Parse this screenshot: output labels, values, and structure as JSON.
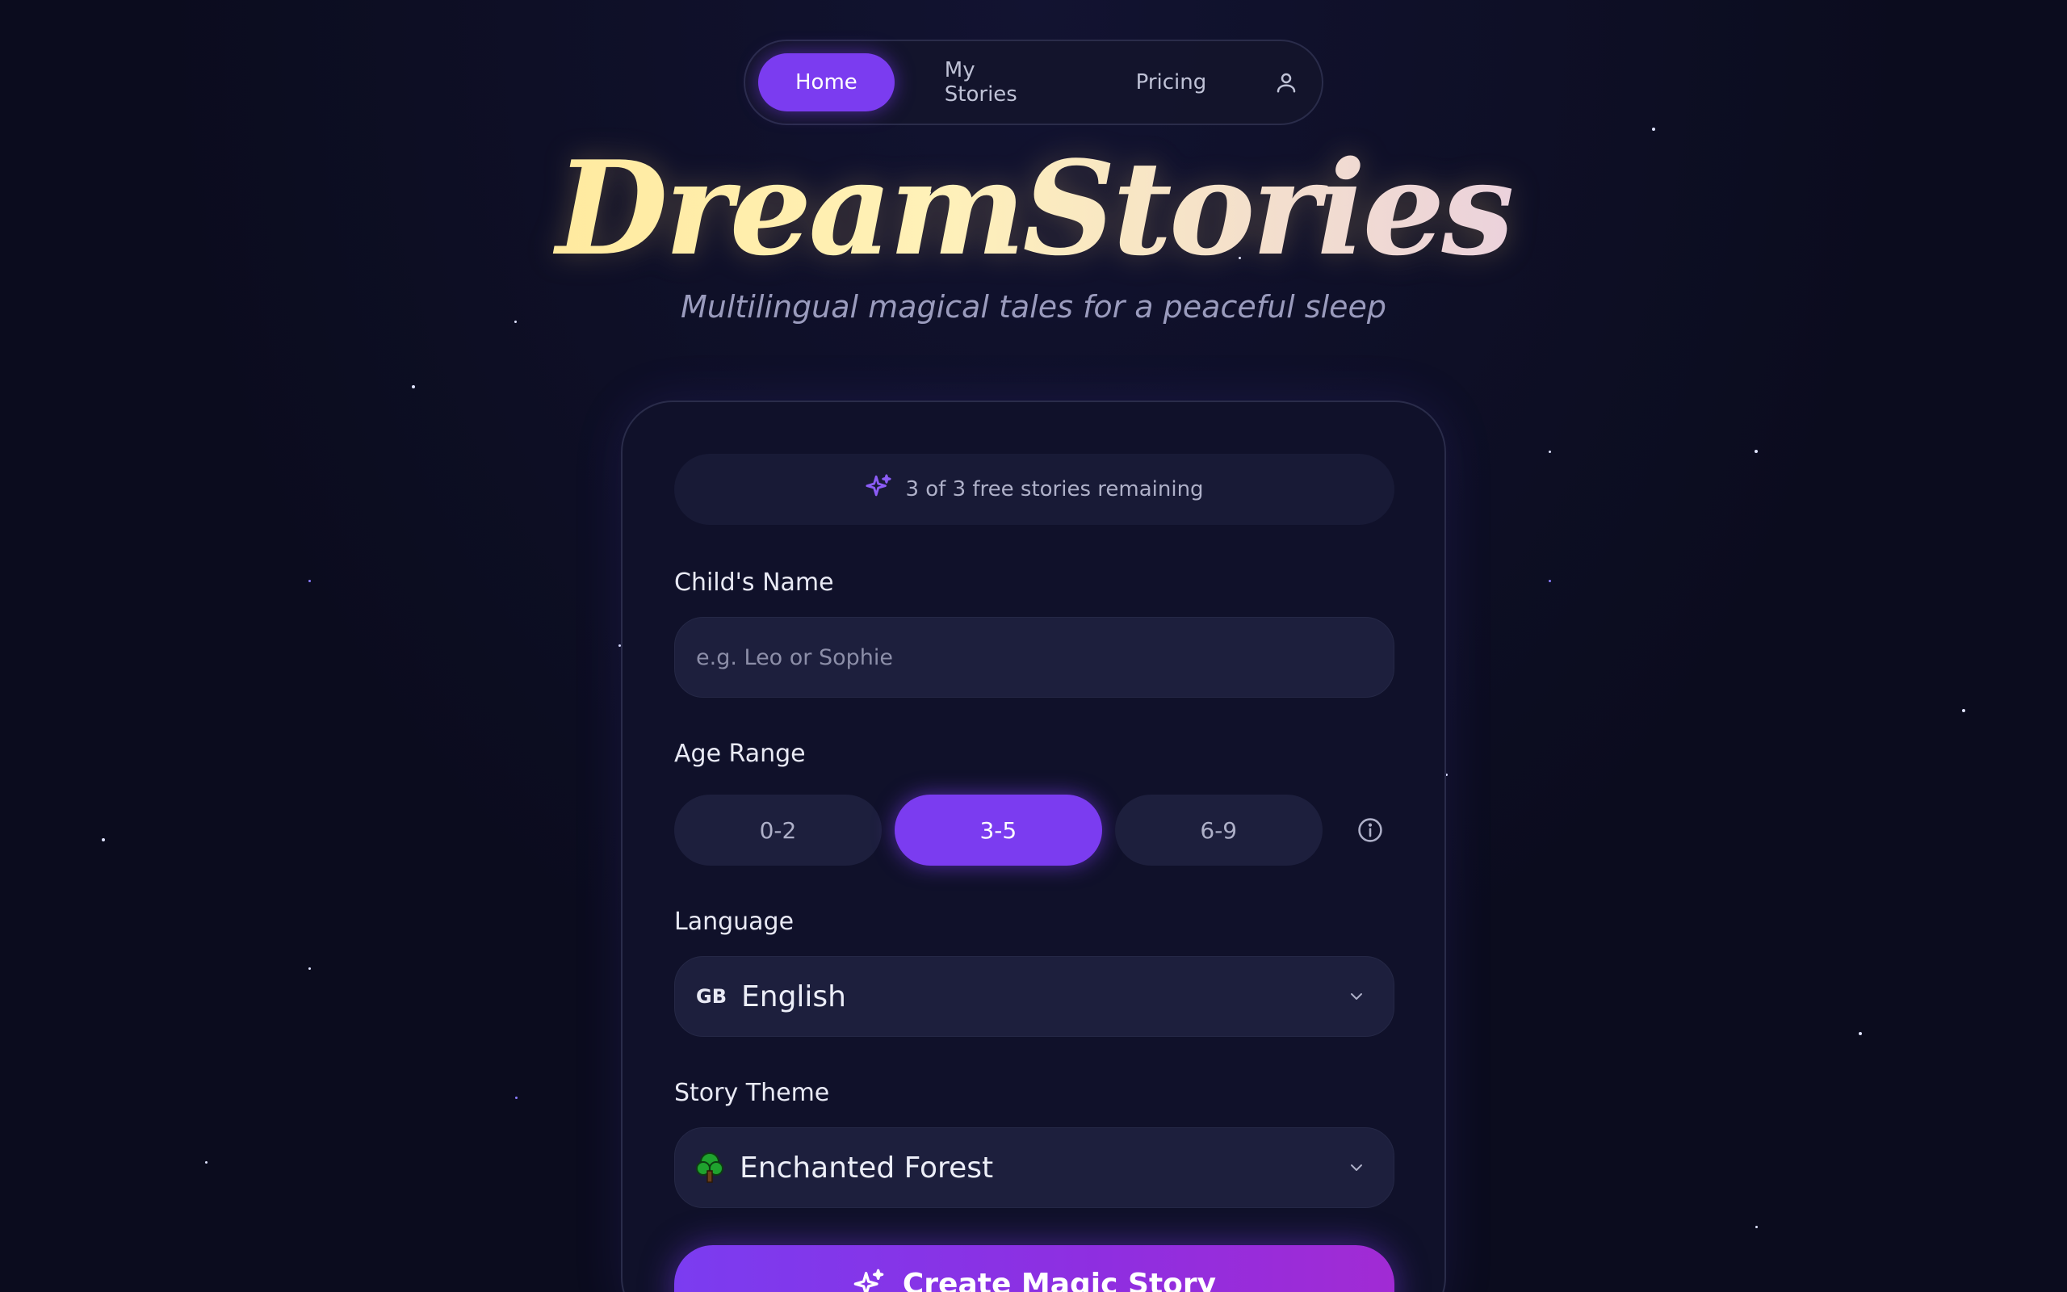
{
  "nav": {
    "items": [
      {
        "label": "Home",
        "active": true
      },
      {
        "label": "My Stories",
        "active": false
      },
      {
        "label": "Pricing",
        "active": false
      }
    ],
    "user_icon": "user-icon"
  },
  "hero": {
    "title": "DreamStories",
    "subtitle": "Multilingual magical tales for a peaceful sleep"
  },
  "form": {
    "banner": {
      "icon": "sparkles-icon",
      "text": "3 of 3 free stories remaining"
    },
    "child_name": {
      "label": "Child's Name",
      "value": "",
      "placeholder": "e.g. Leo or Sophie"
    },
    "age_range": {
      "label": "Age Range",
      "options": [
        {
          "label": "0-2",
          "selected": false
        },
        {
          "label": "3-5",
          "selected": true
        },
        {
          "label": "6-9",
          "selected": false
        }
      ],
      "info_icon": "info-icon"
    },
    "language": {
      "label": "Language",
      "flag": "GB",
      "value": "English",
      "icon": "chevron-down-icon"
    },
    "story_theme": {
      "label": "Story Theme",
      "icon": "tree-icon",
      "value": "Enchanted Forest"
    },
    "submit": {
      "label": "Create Magic Story",
      "icon": "sparkles-icon"
    }
  },
  "colors": {
    "background": "#0b0c1e",
    "accent": "#7b3cf0",
    "card": "#10112a",
    "field": "#1d1f3d",
    "title_gradient_start": "#ffe07a",
    "title_gradient_end": "#d8b4fe"
  }
}
